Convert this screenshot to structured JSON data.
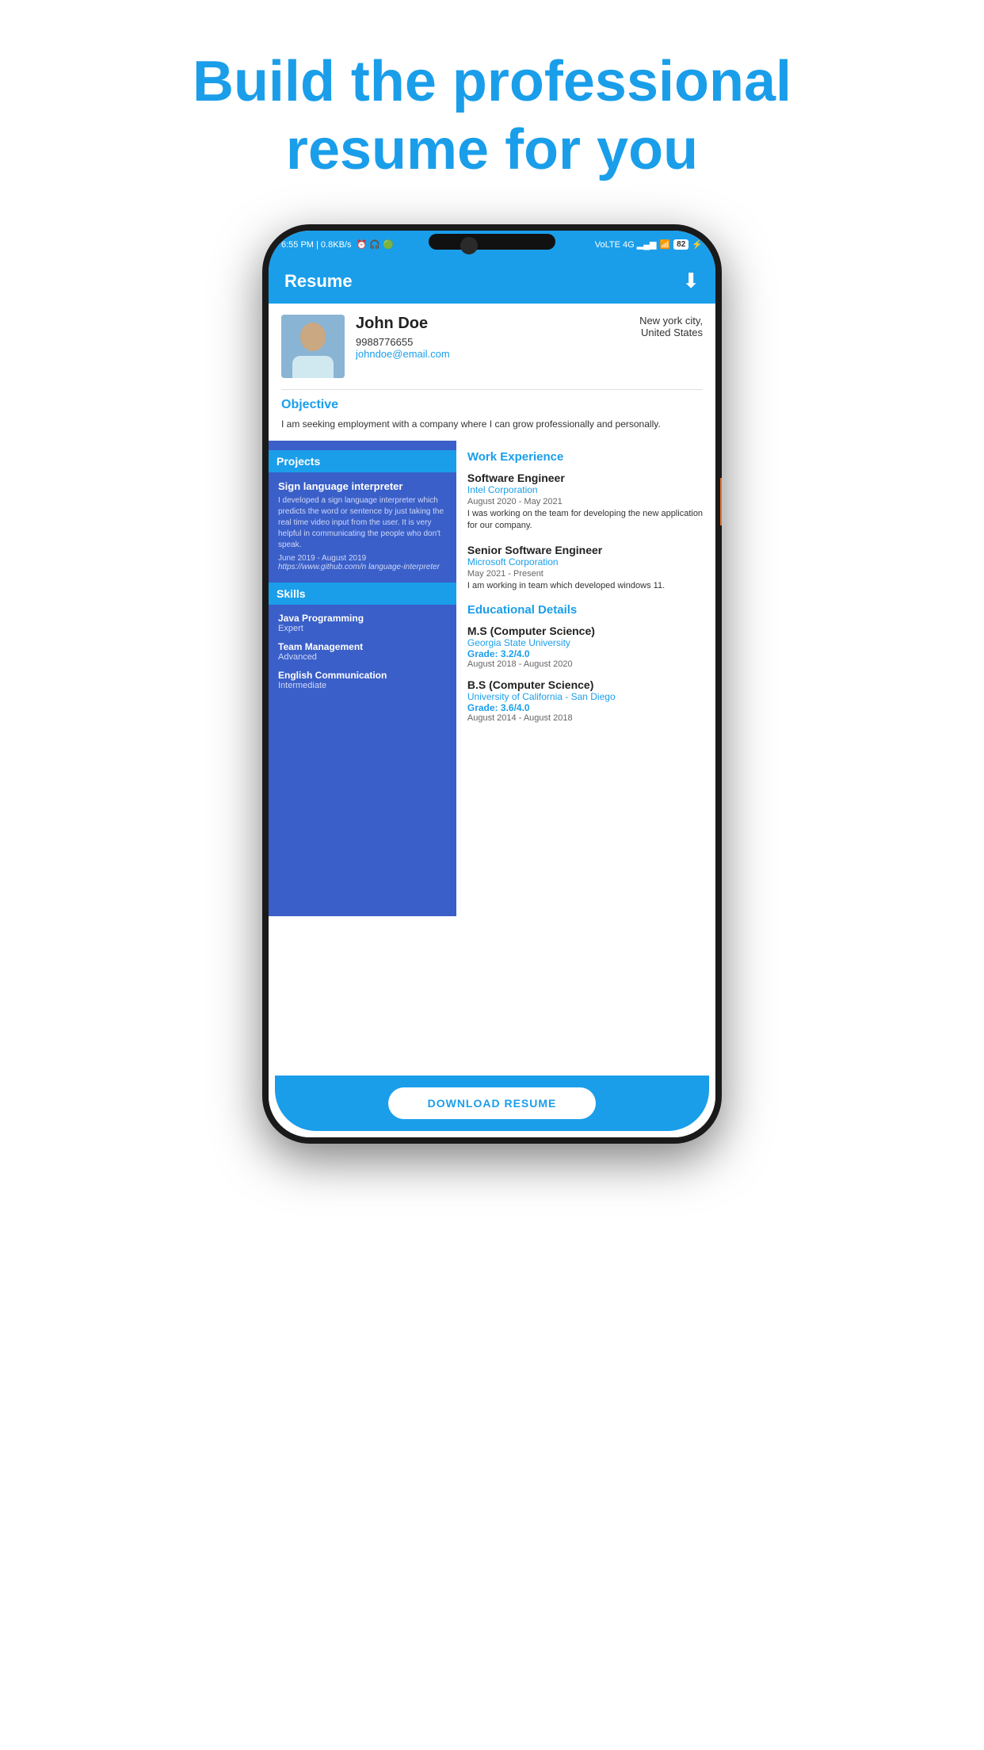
{
  "page": {
    "headline_line1": "Build the professional",
    "headline_line2": "resume for you"
  },
  "status_bar": {
    "time": "6:55 PM | 0.8KB/s",
    "battery": "82"
  },
  "app_header": {
    "title": "Resume",
    "download_label": "⬇"
  },
  "profile": {
    "name": "John Doe",
    "phone": "9988776655",
    "email": "johndoe@email.com",
    "city": "New york city,",
    "country": "United States"
  },
  "objective": {
    "label": "Objective",
    "text": "I am seeking employment with a company where I can grow professionally and personally."
  },
  "projects": {
    "label": "Projects",
    "items": [
      {
        "title": "Sign language interpreter",
        "description": "I developed a sign language interpreter which predicts the word or sentence by just taking the real time video input from the user. It is very helpful in communicating the people who don't speak.",
        "date": "June 2019 - August 2019",
        "link": "https://www.github.com/n language-interpreter"
      }
    ]
  },
  "skills": {
    "label": "Skills",
    "items": [
      {
        "name": "Java Programming",
        "level": "Expert"
      },
      {
        "name": "Team Management",
        "level": "Advanced"
      },
      {
        "name": "English Communication",
        "level": "Intermediate"
      }
    ]
  },
  "work_experience": {
    "label": "Work Experience",
    "jobs": [
      {
        "title": "Software Engineer",
        "company": "Intel Corporation",
        "date": "August 2020 - May 2021",
        "description": "I was working on the team for developing the new application for our company."
      },
      {
        "title": "Senior Software Engineer",
        "company": "Microsoft Corporation",
        "date": "May 2021 - Present",
        "description": "I am working in team which developed windows 11."
      }
    ]
  },
  "education": {
    "label": "Educational Details",
    "items": [
      {
        "degree": "M.S (Computer Science)",
        "university": "Georgia State University",
        "grade_label": "Grade: ",
        "grade": "3.2/4.0",
        "date": "August 2018 - August 2020"
      },
      {
        "degree": "B.S (Computer Science)",
        "university": "University of California - San Diego",
        "grade_label": "Grade: ",
        "grade": "3.6/4.0",
        "date": "August 2014 - August 2018"
      }
    ]
  },
  "download_button": {
    "label": "DOWNLOAD RESUME"
  }
}
